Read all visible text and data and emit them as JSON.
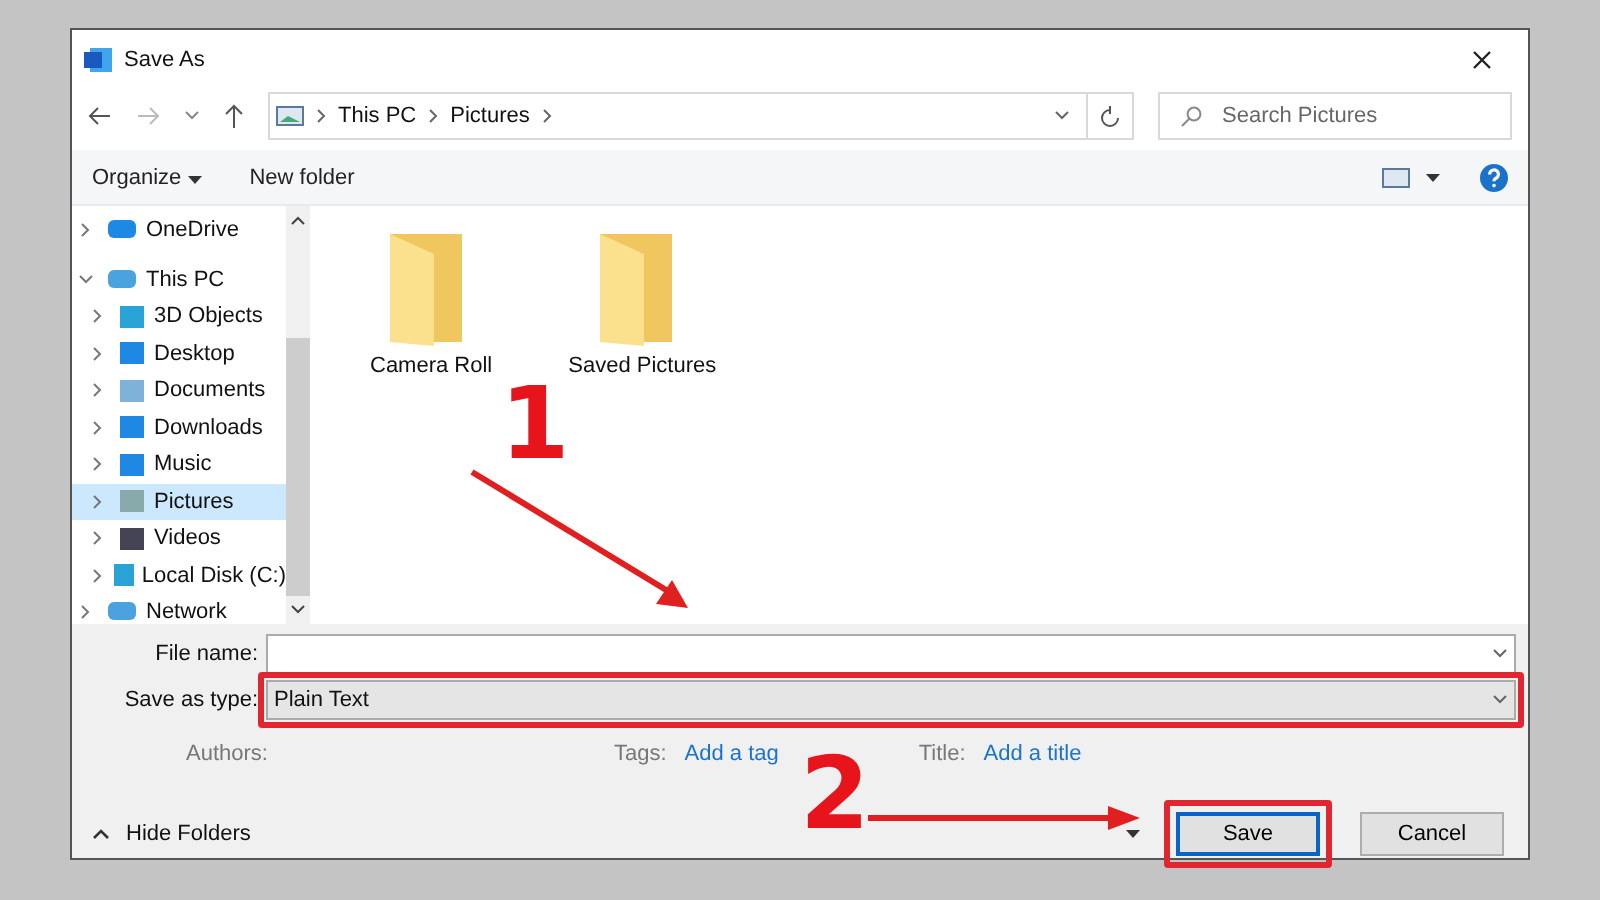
{
  "window": {
    "title": "Save As"
  },
  "address": {
    "path": [
      "This PC",
      "Pictures"
    ]
  },
  "search": {
    "placeholder": "Search Pictures"
  },
  "toolbar": {
    "organize": "Organize",
    "new_folder": "New folder"
  },
  "sidebar": {
    "items": [
      {
        "label": "OneDrive",
        "expanded": false,
        "selected": false
      },
      {
        "label": "This PC",
        "expanded": true,
        "selected": false,
        "children": [
          {
            "label": "3D Objects",
            "expanded": false,
            "selected": false
          },
          {
            "label": "Desktop",
            "expanded": false,
            "selected": false
          },
          {
            "label": "Documents",
            "expanded": false,
            "selected": false
          },
          {
            "label": "Downloads",
            "expanded": false,
            "selected": false
          },
          {
            "label": "Music",
            "expanded": false,
            "selected": false
          },
          {
            "label": "Pictures",
            "expanded": false,
            "selected": true
          },
          {
            "label": "Videos",
            "expanded": false,
            "selected": false
          },
          {
            "label": "Local Disk (C:)",
            "expanded": false,
            "selected": false
          }
        ]
      },
      {
        "label": "Network",
        "expanded": false,
        "selected": false
      }
    ]
  },
  "folders": [
    {
      "name": "Camera Roll"
    },
    {
      "name": "Saved Pictures"
    }
  ],
  "form": {
    "file_name_label": "File name:",
    "type_label": "Save as type:",
    "type": "Plain Text",
    "type_highlighted": true,
    "authors_label": "Authors:",
    "tags_label": "Tags:",
    "tags_link": "Add a tag",
    "title_label": "Title:",
    "title_link": "Add a title"
  },
  "footer": {
    "hide_folders": "Hide Folders",
    "buttons": [
      {
        "label": "Save",
        "default": true,
        "highlighted": true
      },
      {
        "label": "Cancel",
        "default": false,
        "highlighted": false
      }
    ]
  },
  "annotations": [
    {
      "label": "1"
    },
    {
      "label": "2"
    }
  ]
}
